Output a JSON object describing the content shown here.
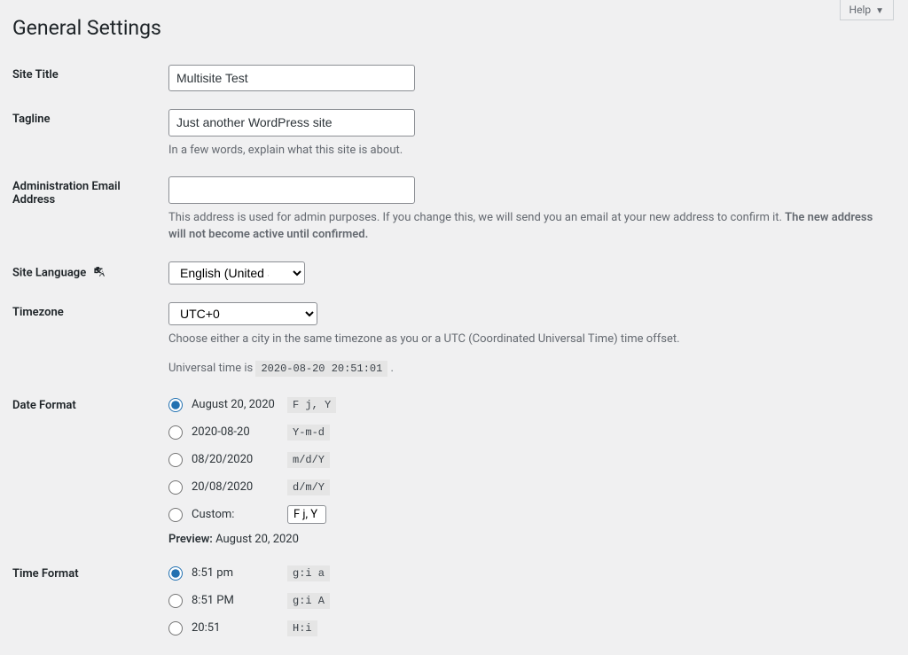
{
  "help": {
    "label": "Help"
  },
  "page_title": "General Settings",
  "fields": {
    "site_title": {
      "label": "Site Title",
      "value": "Multisite Test"
    },
    "tagline": {
      "label": "Tagline",
      "value": "Just another WordPress site",
      "hint": "In a few words, explain what this site is about."
    },
    "admin_email": {
      "label": "Administration Email Address",
      "value": "",
      "hint_pre": "This address is used for admin purposes. If you change this, we will send you an email at your new address to confirm it. ",
      "hint_strong": "The new address will not become active until confirmed."
    },
    "site_language": {
      "label": "Site Language",
      "value": "English (United States)"
    },
    "timezone": {
      "label": "Timezone",
      "value": "UTC+0",
      "hint": "Choose either a city in the same timezone as you or a UTC (Coordinated Universal Time) time offset.",
      "universal_label": "Universal time is ",
      "universal_value": "2020-08-20 20:51:01",
      "period": "."
    },
    "date_format": {
      "label": "Date Format",
      "options": [
        {
          "label": "August 20, 2020",
          "code": "F j, Y",
          "checked": true
        },
        {
          "label": "2020-08-20",
          "code": "Y-m-d",
          "checked": false
        },
        {
          "label": "08/20/2020",
          "code": "m/d/Y",
          "checked": false
        },
        {
          "label": "20/08/2020",
          "code": "d/m/Y",
          "checked": false
        }
      ],
      "custom_label": "Custom:",
      "custom_value": "F j, Y",
      "preview_label": "Preview:",
      "preview_value": " August 20, 2020"
    },
    "time_format": {
      "label": "Time Format",
      "options": [
        {
          "label": "8:51 pm",
          "code": "g:i a",
          "checked": true
        },
        {
          "label": "8:51 PM",
          "code": "g:i A",
          "checked": false
        },
        {
          "label": "20:51",
          "code": "H:i",
          "checked": false
        }
      ]
    }
  }
}
